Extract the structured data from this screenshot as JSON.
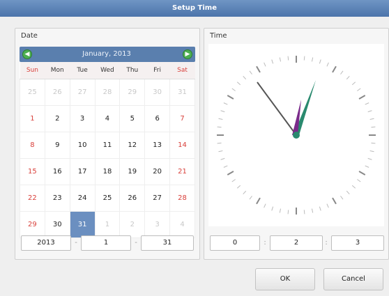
{
  "window": {
    "title": "Setup Time"
  },
  "date_panel": {
    "label": "Date",
    "month_label": "January, 2013",
    "prev_icon": "chevron-left-icon",
    "next_icon": "chevron-right-icon",
    "weekdays": [
      "Sun",
      "Mon",
      "Tue",
      "Wed",
      "Thu",
      "Fri",
      "Sat"
    ],
    "weeks": [
      [
        "25",
        "26",
        "27",
        "28",
        "29",
        "30",
        "31"
      ],
      [
        "1",
        "2",
        "3",
        "4",
        "5",
        "6",
        "7"
      ],
      [
        "8",
        "9",
        "10",
        "11",
        "12",
        "13",
        "14"
      ],
      [
        "15",
        "16",
        "17",
        "18",
        "19",
        "20",
        "21"
      ],
      [
        "22",
        "23",
        "24",
        "25",
        "26",
        "27",
        "28"
      ],
      [
        "29",
        "30",
        "31",
        "1",
        "2",
        "3",
        "4"
      ]
    ],
    "selected_day": "31",
    "year_value": "2013",
    "month_value": "1",
    "day_value": "31"
  },
  "time_panel": {
    "label": "Time",
    "hour_value": "0",
    "minute_value": "2",
    "second_value": "3"
  },
  "buttons": {
    "ok_label": "OK",
    "cancel_label": "Cancel"
  },
  "colors": {
    "titlebar": "#5a80b3",
    "accent": "#6b8fc0",
    "weekend": "#d9403b",
    "hand": "#2a8a6f"
  }
}
